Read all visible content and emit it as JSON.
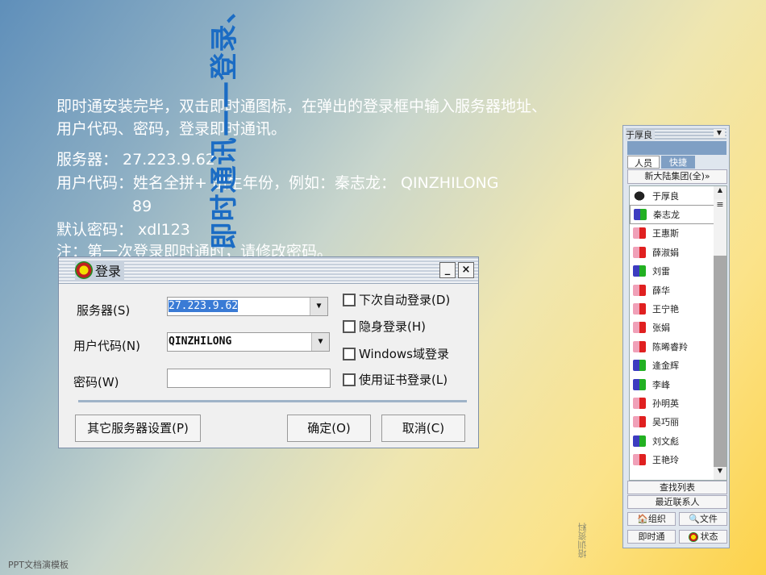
{
  "title": "即时通讯——登录、",
  "intro_line1": "即时通安装完毕，双击即时通图标，在弹出的登录框中输入服务器地址、",
  "intro_line2": "用户代码、密码，登录即时通讯。",
  "server_line": "服务器： 27.223.9.62",
  "usercode_line": "用户代码：姓名全拼+ 出生年份，例如：秦志龙： QINZHILONG",
  "usercode_line_cont": "89",
  "password_line": "默认密码： xdl123",
  "note_line": "注：第一次登录即时通时，请修改密码。",
  "footer_left": "PPT文档演模板",
  "footer_right": "培训资料",
  "dialog": {
    "title": "登录",
    "minimize": "_",
    "close": "×",
    "server_label": "服务器(S)",
    "server_value": "27.223.9.62",
    "usercode_label": "用户代码(N)",
    "usercode_value": "QINZHILONG",
    "password_label": "密码(W)",
    "password_value": "",
    "checkboxes": [
      {
        "label": "下次自动登录(D)",
        "checked": false
      },
      {
        "label": "隐身登录(H)",
        "checked": false
      },
      {
        "label": "Windows域登录",
        "checked": false
      },
      {
        "label": "使用证书登录(L)",
        "checked": false
      }
    ],
    "other_server_button": "其它服务器设置(P)",
    "ok_button": "确定(O)",
    "cancel_button": "取消(C)"
  },
  "panel": {
    "user": "于厚良",
    "tabs": [
      "人员",
      "快捷"
    ],
    "group": "新大陆集团(全)»",
    "contacts": [
      {
        "name": "于厚良",
        "color": "#222"
      },
      {
        "name": "秦志龙",
        "color": "#3c3cc0"
      },
      {
        "name": "王惠斯",
        "color": "#f0a0b8"
      },
      {
        "name": "薛淑娟",
        "color": "#f0a0b8"
      },
      {
        "name": "刘雷",
        "color": "#3c3cc0"
      },
      {
        "name": "薛华",
        "color": "#f0a0b8"
      },
      {
        "name": "王宁艳",
        "color": "#f0a0b8"
      },
      {
        "name": "张娟",
        "color": "#f0a0b8"
      },
      {
        "name": "陈晞睿羚",
        "color": "#f0a0b8"
      },
      {
        "name": "逄金辉",
        "color": "#3c3cc0"
      },
      {
        "name": "李峰",
        "color": "#3c3cc0"
      },
      {
        "name": "孙明英",
        "color": "#f0a0b8"
      },
      {
        "name": "吴巧丽",
        "color": "#f0a0b8"
      },
      {
        "name": "刘文彪",
        "color": "#3c3cc0"
      },
      {
        "name": "王艳玲",
        "color": "#f0a0b8"
      }
    ],
    "find_list": "查找列表",
    "recent": "最近联系人",
    "org": "组织",
    "files": "文件",
    "im": "即时通",
    "status": "状态"
  }
}
